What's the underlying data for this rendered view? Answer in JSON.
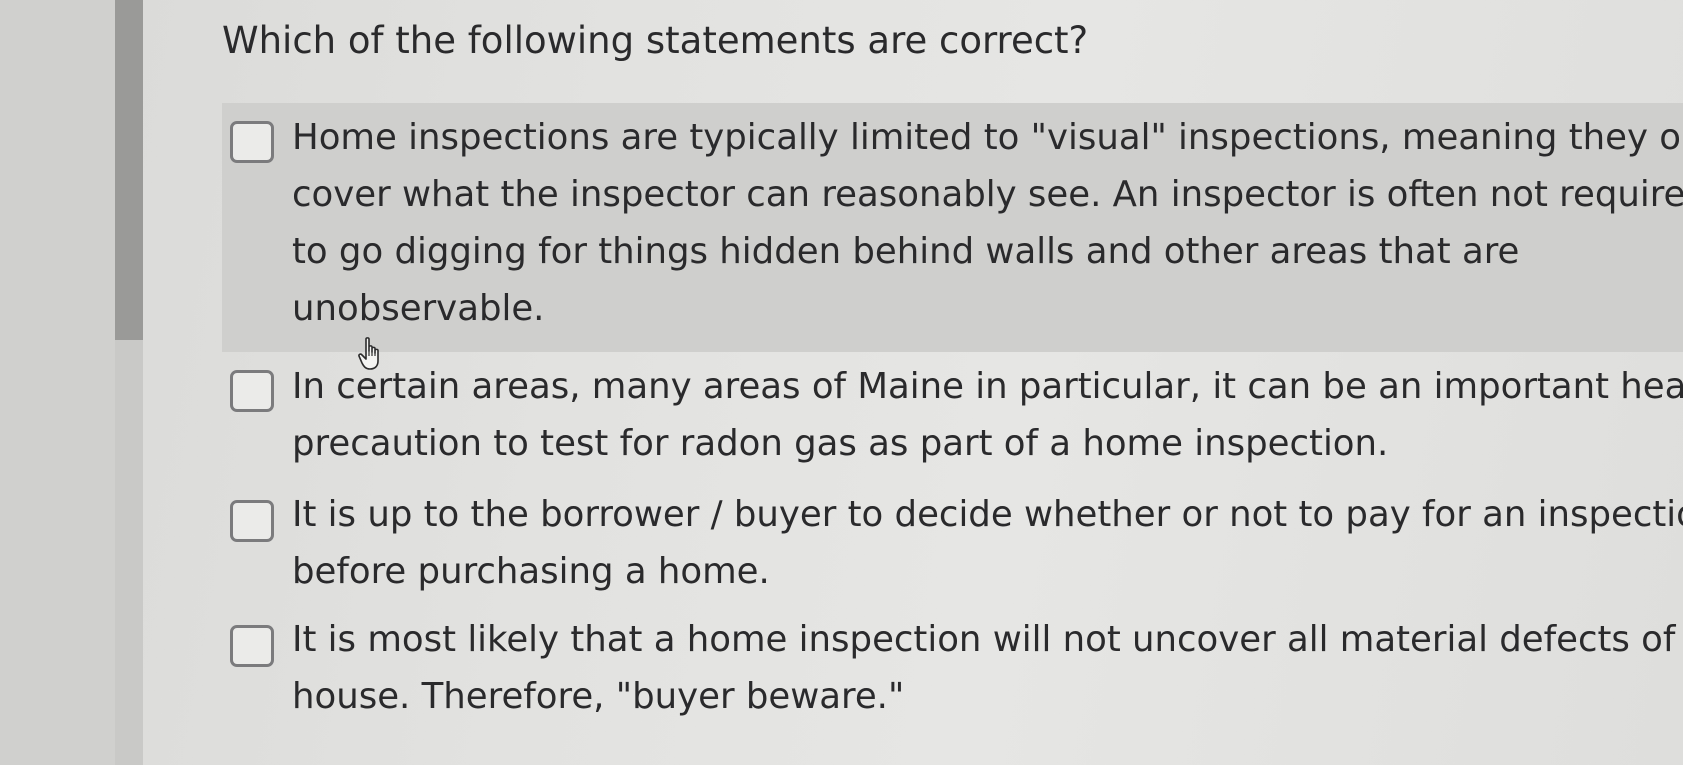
{
  "question": {
    "title": "Which of the following statements are correct?"
  },
  "options": [
    {
      "lines": [
        "Home inspections are typically limited to \"visual\" inspections, meaning they only",
        "cover what the inspector can reasonably see. An inspector is often not required",
        "to go digging for things hidden behind walls and other areas that are",
        "unobservable."
      ],
      "checked": false,
      "highlighted": true
    },
    {
      "lines": [
        "In certain areas, many areas of Maine in particular, it can be an important health",
        "precaution to test for radon gas as part of a home inspection."
      ],
      "checked": false,
      "highlighted": false
    },
    {
      "lines": [
        "It is up to the borrower / buyer to decide whether or not to pay for an inspection",
        "before purchasing a home."
      ],
      "checked": false,
      "highlighted": false
    },
    {
      "lines": [
        "It is most likely that a home inspection will not uncover all material defects of a",
        "house. Therefore, \"buyer beware.\""
      ],
      "checked": false,
      "highlighted": false
    }
  ],
  "colors": {
    "highlight": "#cfcfcd",
    "text": "#2a2a2c",
    "checkbox_border": "#7b7b7d",
    "scroll_thumb": "#9a9a98"
  },
  "icons": {
    "cursor": "hand-pointer-icon"
  }
}
